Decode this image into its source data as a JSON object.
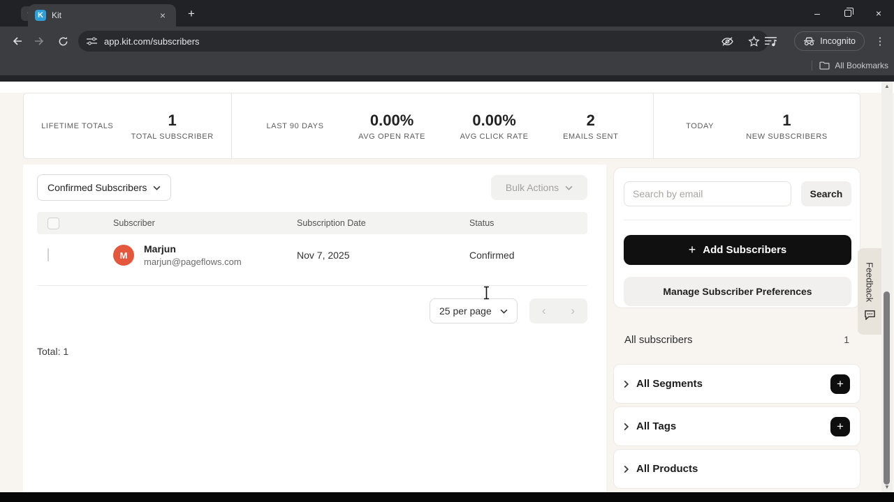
{
  "browser": {
    "tab_title": "Kit",
    "favicon_letter": "K",
    "url": "app.kit.com/subscribers",
    "incognito_label": "Incognito",
    "bookmarks_label": "All Bookmarks"
  },
  "icons": {
    "close_glyph": "×",
    "plus_glyph": "+",
    "minimize_glyph": "–",
    "menu_dots_glyph": "⋮",
    "chevron_left_glyph": "‹",
    "chevron_right_glyph": "›",
    "scroll_up_glyph": "▲",
    "scroll_down_glyph": "▼"
  },
  "colors": {
    "accent_black": "#101010",
    "avatar": "#e4573d",
    "favicon_blue": "#2e9fd9",
    "page_background": "#f8f5f1"
  },
  "stats": {
    "sections": [
      {
        "label": "LIFETIME TOTALS",
        "items": [
          {
            "value": "1",
            "caption": "TOTAL SUBSCRIBER"
          }
        ]
      },
      {
        "label": "LAST 90 DAYS",
        "items": [
          {
            "value": "0.00%",
            "caption": "AVG OPEN RATE"
          },
          {
            "value": "0.00%",
            "caption": "AVG CLICK RATE"
          },
          {
            "value": "2",
            "caption": "EMAILS SENT"
          }
        ]
      },
      {
        "label": "TODAY",
        "items": [
          {
            "value": "1",
            "caption": "NEW SUBSCRIBERS"
          }
        ]
      }
    ]
  },
  "main": {
    "filter_label": "Confirmed Subscribers",
    "bulk_actions_label": "Bulk Actions",
    "total_label": "Total: 1"
  },
  "table": {
    "headers": [
      "Subscriber",
      "Subscription Date",
      "Status"
    ],
    "row": {
      "initial": "M",
      "name": "Marjun",
      "email": "marjun@pageflows.com",
      "date": "Nov 7, 2025",
      "status": "Confirmed"
    }
  },
  "pagination": {
    "per_page_label": "25 per page"
  },
  "sidebar": {
    "search_placeholder": "Search by email",
    "search_button_label": "Search",
    "add_subscribers_label": "Add Subscribers",
    "manage_preferences_label": "Manage Subscriber Preferences",
    "all_subscribers_label": "All subscribers",
    "all_subscribers_count": "1",
    "groups": [
      {
        "label": "All Segments"
      },
      {
        "label": "All Tags"
      },
      {
        "label": "All Products"
      }
    ]
  },
  "feedback": {
    "label": "Feedback"
  }
}
